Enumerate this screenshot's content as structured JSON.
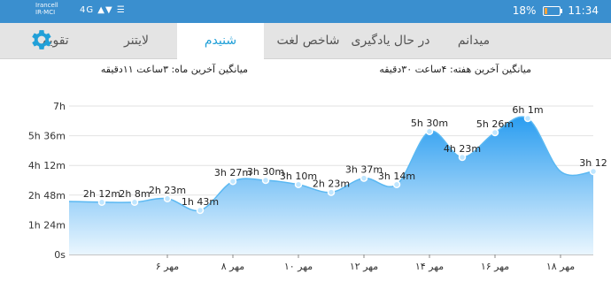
{
  "status": {
    "carrier1": "Irancell",
    "carrier2": "IR-MCI",
    "signal": "4G ▲▼ ☰",
    "battery": "18%",
    "time": "11:34",
    "battery_level": 0.18
  },
  "tabs": [
    {
      "label": "تقویم",
      "active": false
    },
    {
      "label": "میدانم",
      "active": false
    },
    {
      "label": "در حال یادگیری",
      "active": false
    },
    {
      "label": "شاخص لغت",
      "active": false
    },
    {
      "label": "شنیدم",
      "active": true
    },
    {
      "label": "لایتنر",
      "active": false
    }
  ],
  "summary": {
    "week": "میانگین آخرین هفته: ۴ساعت ۳۰دقیقه",
    "month": "میانگین آخرین ماه: ۳ساعت ۱۱دقیقه"
  },
  "colors": {
    "accent": "#21a0d8",
    "statusbar": "#3a8fcf",
    "area_top": "#3aa7f0",
    "area_bottom": "#e9f5fd"
  },
  "chart_data": {
    "type": "area",
    "y_unit": "minutes",
    "ylim": [
      0,
      420
    ],
    "y_ticks": [
      0,
      84,
      168,
      252,
      336,
      420
    ],
    "y_tick_labels": [
      "0s",
      "1h 24m",
      "2h 48m",
      "4h 12m",
      "5h 36m",
      "7h"
    ],
    "x": [
      3,
      4,
      5,
      6,
      7,
      8,
      9,
      10,
      11,
      12,
      13,
      14,
      15,
      16,
      17,
      18,
      19
    ],
    "x_ticks": [
      6,
      8,
      10,
      12,
      14,
      16,
      18
    ],
    "x_tick_labels": [
      "۶ مهر",
      "۸ مهر",
      "۱۰ مهر",
      "۱۲ مهر",
      "۱۴ مهر",
      "۱۶ مهر",
      "۱۸ مهر"
    ],
    "values": [
      150,
      148,
      148,
      158,
      125,
      207,
      210,
      198,
      176,
      216,
      198,
      348,
      275,
      345,
      385,
      235,
      235
    ],
    "point_labels": [
      "",
      "2h 12m",
      "2h 8m",
      "2h 23m",
      "1h 43m",
      "3h 27m",
      "3h 30m",
      "3h 10m",
      "2h 23m",
      "3h 37m",
      "3h 14m",
      "5h 30m",
      "4h 23m",
      "5h 26m",
      "6h 1m",
      "",
      "3h 12"
    ],
    "grid": true
  }
}
